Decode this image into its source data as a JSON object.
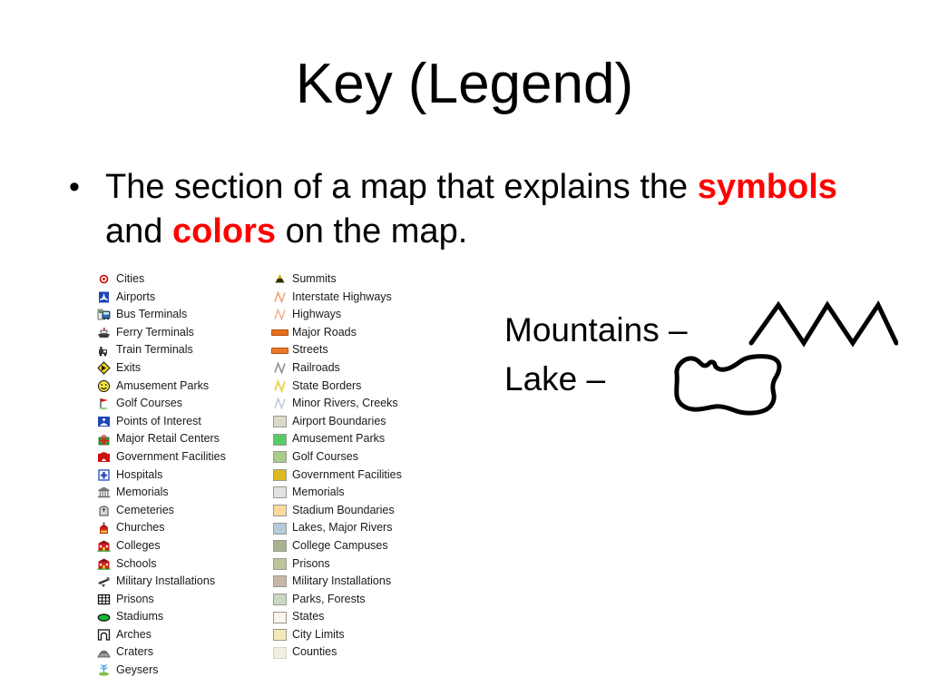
{
  "slide": {
    "title": "Key (Legend)",
    "bullet_marker": "•",
    "body": {
      "part1": "The section of a map that explains the ",
      "highlight1": "symbols",
      "part2": " and ",
      "highlight2": "colors",
      "part3": " on the map.",
      "highlight_color": "#ff0000"
    }
  },
  "annotations": {
    "mountains_label": "Mountains –",
    "lake_label": "Lake –",
    "mountains_sketch": "mountain-zigzag-sketch",
    "lake_sketch": "lake-outline-sketch"
  },
  "legend": {
    "left_column": [
      {
        "label": "Cities",
        "icon": "cities-icon",
        "kind": "icon"
      },
      {
        "label": "Airports",
        "icon": "airports-icon",
        "kind": "icon"
      },
      {
        "label": "Bus Terminals",
        "icon": "bus-terminals-icon",
        "kind": "icon"
      },
      {
        "label": "Ferry Terminals",
        "icon": "ferry-terminals-icon",
        "kind": "icon"
      },
      {
        "label": "Train Terminals",
        "icon": "train-terminals-icon",
        "kind": "icon"
      },
      {
        "label": "Exits",
        "icon": "exits-icon",
        "kind": "icon"
      },
      {
        "label": "Amusement Parks",
        "icon": "amusement-parks-icon",
        "kind": "icon"
      },
      {
        "label": "Golf Courses",
        "icon": "golf-courses-icon",
        "kind": "icon"
      },
      {
        "label": "Points of Interest",
        "icon": "points-of-interest-icon",
        "kind": "icon"
      },
      {
        "label": "Major Retail Centers",
        "icon": "major-retail-centers-icon",
        "kind": "icon"
      },
      {
        "label": "Government Facilities",
        "icon": "government-facilities-icon",
        "kind": "icon"
      },
      {
        "label": "Hospitals",
        "icon": "hospitals-icon",
        "kind": "icon"
      },
      {
        "label": "Memorials",
        "icon": "memorials-icon",
        "kind": "icon"
      },
      {
        "label": "Cemeteries",
        "icon": "cemeteries-icon",
        "kind": "icon"
      },
      {
        "label": "Churches",
        "icon": "churches-icon",
        "kind": "icon"
      },
      {
        "label": "Colleges",
        "icon": "colleges-icon",
        "kind": "icon"
      },
      {
        "label": "Schools",
        "icon": "schools-icon",
        "kind": "icon"
      },
      {
        "label": "Military Installations",
        "icon": "military-installations-icon",
        "kind": "icon"
      },
      {
        "label": "Prisons",
        "icon": "prisons-icon",
        "kind": "icon"
      },
      {
        "label": "Stadiums",
        "icon": "stadiums-icon",
        "kind": "icon"
      },
      {
        "label": "Arches",
        "icon": "arches-icon",
        "kind": "icon"
      },
      {
        "label": "Craters",
        "icon": "craters-icon",
        "kind": "icon"
      },
      {
        "label": "Geysers",
        "icon": "geysers-icon",
        "kind": "icon"
      }
    ],
    "right_column": [
      {
        "label": "Summits",
        "icon": "summit-triangle-icon",
        "kind": "icon",
        "color": "#2f2f00"
      },
      {
        "label": "Interstate Highways",
        "icon": "interstate-line-icon",
        "kind": "line",
        "color": "#f0a070"
      },
      {
        "label": "Highways",
        "icon": "highway-line-icon",
        "kind": "line",
        "color": "#f2b089"
      },
      {
        "label": "Major Roads",
        "icon": "major-road-bar-icon",
        "kind": "bar",
        "color": "#e8701c"
      },
      {
        "label": "Streets",
        "icon": "street-bar-icon",
        "kind": "bar",
        "color": "#ea7a2a"
      },
      {
        "label": "Railroads",
        "icon": "railroad-line-icon",
        "kind": "line",
        "color": "#8a8a8a"
      },
      {
        "label": "State Borders",
        "icon": "state-border-line-icon",
        "kind": "line",
        "color": "#e8d86a"
      },
      {
        "label": "Minor Rivers, Creeks",
        "icon": "river-line-icon",
        "kind": "line",
        "color": "#b8c8d8"
      },
      {
        "label": "Airport Boundaries",
        "icon": "airport-area-swatch",
        "kind": "swatch",
        "color": "#ded8cc"
      },
      {
        "label": "Amusement Parks",
        "icon": "amusement-area-swatch",
        "kind": "swatch",
        "color": "#55cc66"
      },
      {
        "label": "Golf Courses",
        "icon": "golf-area-swatch",
        "kind": "swatch",
        "color": "#a9cd8b"
      },
      {
        "label": "Government Facilities",
        "icon": "government-area-swatch",
        "kind": "swatch",
        "color": "#dcbb22"
      },
      {
        "label": "Memorials",
        "icon": "memorial-area-swatch",
        "kind": "swatch",
        "color": "#e2e2e2"
      },
      {
        "label": "Stadium Boundaries",
        "icon": "stadium-area-swatch",
        "kind": "swatch",
        "color": "#fada9e"
      },
      {
        "label": "Lakes, Major Rivers",
        "icon": "lake-area-swatch",
        "kind": "swatch",
        "color": "#b6cada"
      },
      {
        "label": "College Campuses",
        "icon": "college-area-swatch",
        "kind": "swatch",
        "color": "#a7b391"
      },
      {
        "label": "Prisons",
        "icon": "prison-area-swatch",
        "kind": "swatch",
        "color": "#c0c49b"
      },
      {
        "label": "Military Installations",
        "icon": "military-area-swatch",
        "kind": "swatch",
        "color": "#c8b6a6"
      },
      {
        "label": "Parks, Forests",
        "icon": "park-area-swatch",
        "kind": "swatch",
        "color": "#ccd8c1"
      },
      {
        "label": "States",
        "icon": "state-area-swatch",
        "kind": "swatch",
        "color": "#faf4ea"
      },
      {
        "label": "City Limits",
        "icon": "city-limit-area-swatch",
        "kind": "swatch",
        "color": "#f4e9b8"
      },
      {
        "label": "Counties",
        "icon": "county-area-swatch",
        "kind": "swatch",
        "color": "#f2eee2"
      }
    ]
  }
}
